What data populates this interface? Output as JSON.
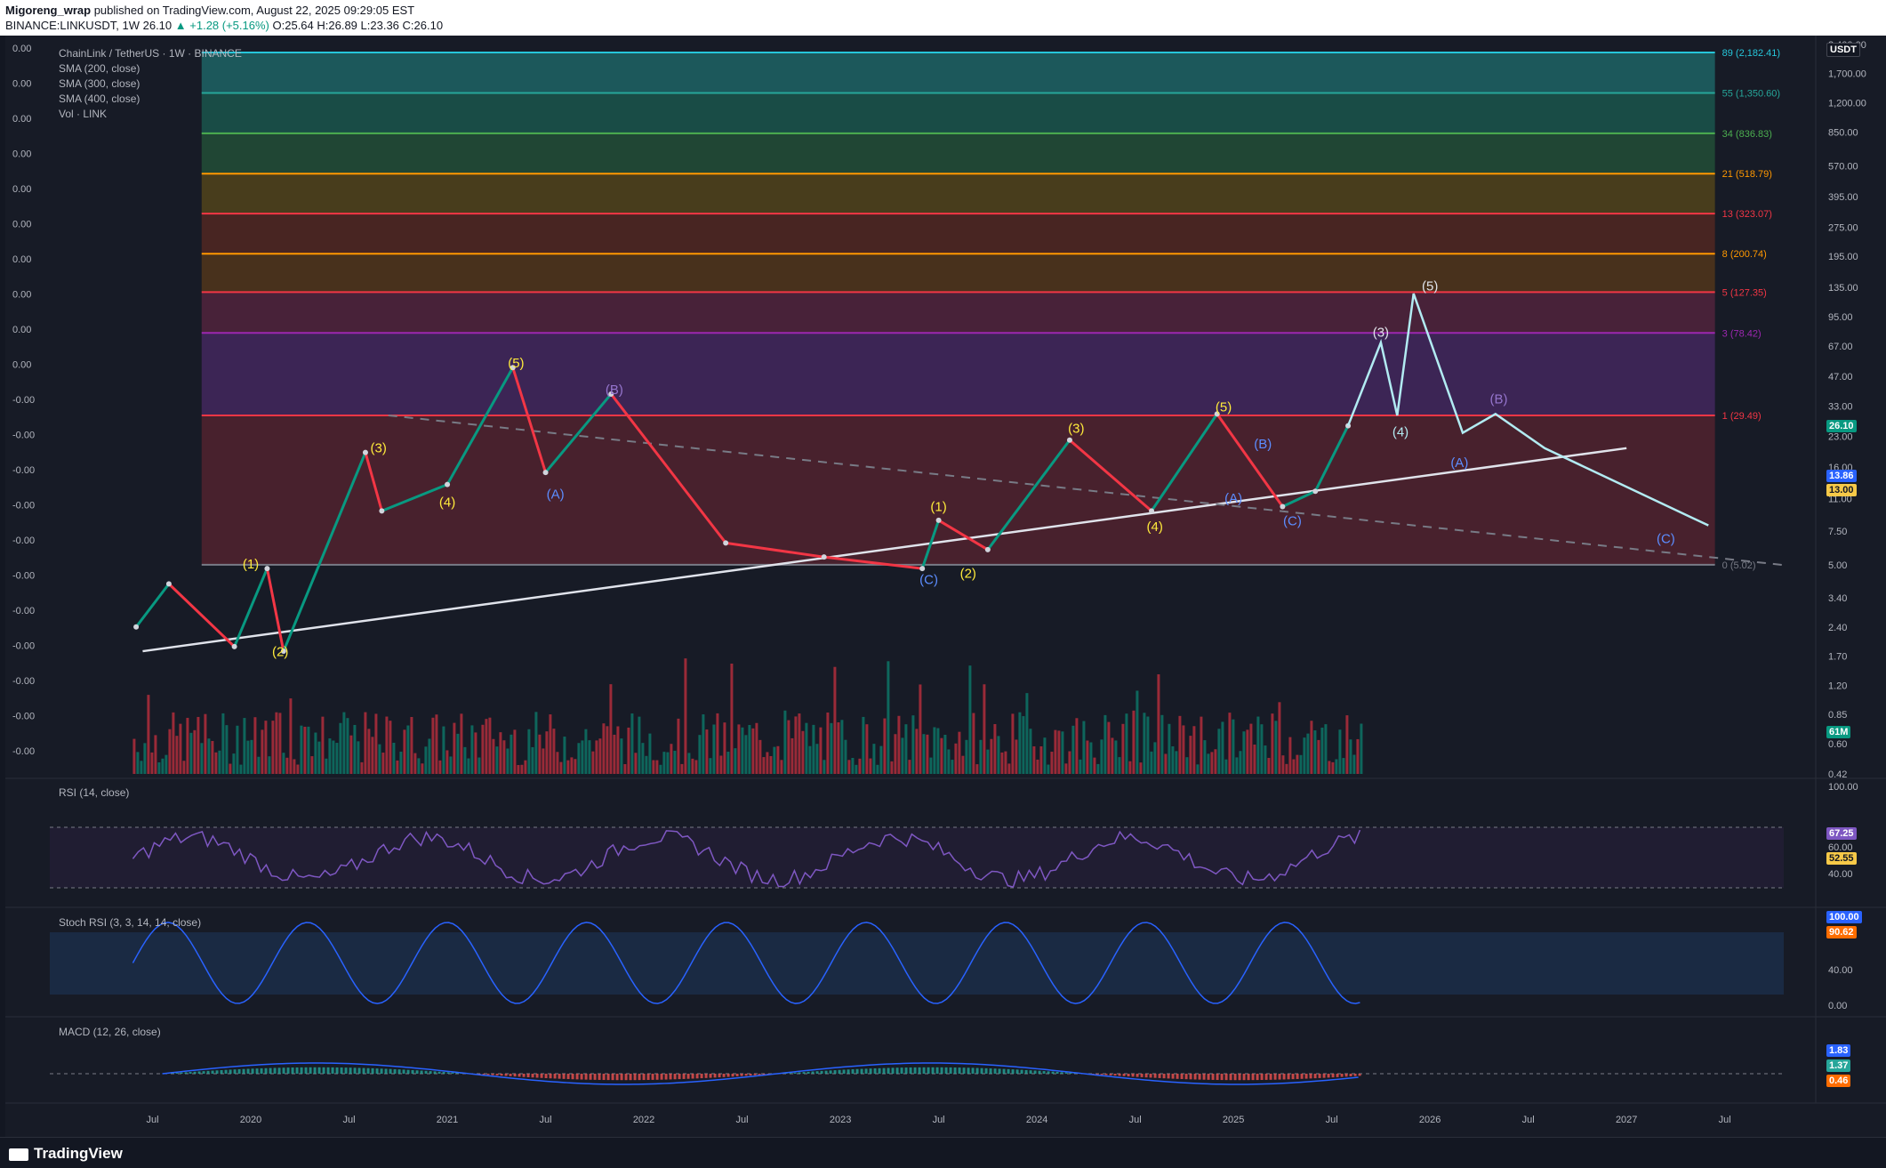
{
  "header": {
    "author": "Migoreng_wrap",
    "published": "published on TradingView.com, August 22, 2025 09:29:05 EST",
    "symbol_line": "BINANCE:LINKUSDT, 1W",
    "last": "26.10",
    "change": "▲ +1.28 (+5.16%)",
    "ohlc": "O:25.64 H:26.89 L:23.36 C:26.10"
  },
  "legend": {
    "title": "ChainLink / TetherUS · 1W · BINANCE",
    "sma200": "SMA (200, close)",
    "sma300": "SMA (300, close)",
    "sma400": "SMA (400, close)",
    "vol": "Vol · LINK",
    "currency": "USDT"
  },
  "left_scale": [
    "0.00",
    "0.00",
    "0.00",
    "0.00",
    "0.00",
    "0.00",
    "0.00",
    "0.00",
    "0.00",
    "0.00",
    "-0.00",
    "-0.00",
    "-0.00",
    "-0.00",
    "-0.00",
    "-0.00",
    "-0.00",
    "-0.00",
    "-0.00",
    "-0.00",
    "-0.00"
  ],
  "fib_labels": [
    "89 (2,182.41)",
    "55 (1,350.60)",
    "34 (836.83)",
    "21 (518.79)",
    "13 (323.07)",
    "8 (200.74)",
    "5 (127.35)",
    "3 (78.42)",
    "1 (29.49)",
    "0 (5.02)"
  ],
  "wave_labels": [
    "(1)",
    "(2)",
    "(3)",
    "(4)",
    "(5)",
    "(A)",
    "(B)",
    "(C)",
    "(1)",
    "(2)",
    "(3)",
    "(4)",
    "(5)",
    "(A)",
    "(B)",
    "(C)",
    "(3)",
    "(4)",
    "(5)",
    "(A)",
    "(B)",
    "(C)"
  ],
  "panes": {
    "rsi": {
      "title": "RSI (14, close)",
      "ticks": [
        "100.00",
        "60.00",
        "40.00"
      ],
      "value": "67.25",
      "ma": "52.55"
    },
    "stoch": {
      "title": "Stoch RSI (3, 3, 14, 14, close)",
      "ticks": [
        "40.00",
        "0.00"
      ],
      "k": "100.00",
      "d": "90.62"
    },
    "macd": {
      "title": "MACD (12, 26, close)",
      "macd": "1.83",
      "hist": "1.37",
      "signal": "0.46"
    }
  },
  "price_tags": {
    "last": "26.10",
    "sma_a": "13.86",
    "sma_b": "13.00",
    "vol": "61M"
  },
  "colors": {
    "up": "#089981",
    "down": "#f23645",
    "background": "#171b26",
    "teal_box": "#1f6e6e",
    "fib_red": "#f23645",
    "fib_orange": "#ff9800",
    "fib_purple": "#9c27b0"
  },
  "footer": {
    "brand": "TradingView"
  },
  "chart_data": {
    "type": "line",
    "title": "ChainLink / TetherUS · 1W · BINANCE",
    "scale": "log",
    "ylim": [
      0.42,
      2400
    ],
    "y_ticks": [
      "2,400.00",
      "1,700.00",
      "1,200.00",
      "850.00",
      "570.00",
      "395.00",
      "275.00",
      "195.00",
      "135.00",
      "95.00",
      "67.00",
      "47.00",
      "33.00",
      "23.00",
      "16.00",
      "11.00",
      "7.50",
      "5.00",
      "3.40",
      "2.40",
      "1.70",
      "1.20",
      "0.85",
      "0.60",
      "0.42"
    ],
    "x_ticks": [
      "Jul",
      "2020",
      "Jul",
      "2021",
      "Jul",
      "2022",
      "Jul",
      "2023",
      "Jul",
      "2024",
      "Jul",
      "2025",
      "Jul",
      "2026",
      "Jul",
      "2027",
      "Jul"
    ],
    "fib_levels": [
      {
        "ratio": 0,
        "price": 5.02
      },
      {
        "ratio": 1,
        "price": 29.49
      },
      {
        "ratio": 3,
        "price": 78.42
      },
      {
        "ratio": 5,
        "price": 127.35
      },
      {
        "ratio": 8,
        "price": 200.74
      },
      {
        "ratio": 13,
        "price": 323.07
      },
      {
        "ratio": 21,
        "price": 518.79
      },
      {
        "ratio": 34,
        "price": 836.83
      },
      {
        "ratio": 55,
        "price": 1350.6
      },
      {
        "ratio": 89,
        "price": 2182.41
      }
    ],
    "series": [
      {
        "name": "LINKUSDT",
        "x": [
          "2019-06",
          "2019-08",
          "2019-12",
          "2020-02",
          "2020-03",
          "2020-08",
          "2020-09",
          "2021-01",
          "2021-05",
          "2021-07",
          "2021-11",
          "2022-06",
          "2022-12",
          "2023-06",
          "2023-07",
          "2023-10",
          "2024-03",
          "2024-08",
          "2024-12",
          "2025-04",
          "2025-06",
          "2025-08"
        ],
        "values": [
          2.4,
          4.0,
          1.9,
          4.8,
          1.8,
          19.0,
          9.5,
          13.0,
          52.0,
          15.0,
          38.0,
          6.5,
          5.5,
          4.8,
          8.5,
          6.0,
          22.0,
          9.5,
          30.0,
          10.0,
          12.0,
          26.1
        ]
      }
    ]
  }
}
